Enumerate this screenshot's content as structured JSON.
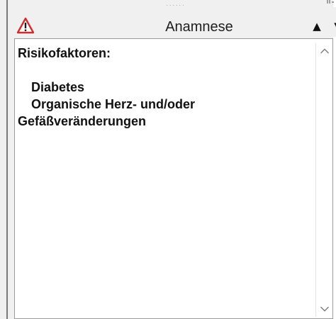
{
  "header": {
    "title": "Anamnese",
    "warning_icon": "warning-triangle-icon",
    "prev_icon": "triangle-up-icon",
    "next_icon": "triangle-down-icon",
    "prev_glyph": "▲",
    "next_glyph": "▼",
    "grip_glyph": "......",
    "accent_color": "#d12b2b"
  },
  "content": {
    "heading": "Risikofaktoren:",
    "items": [
      "Diabetes",
      "Organische Herz- und/oder",
      "Gefäßveränderungen"
    ]
  },
  "scrollbar": {
    "up_icon": "chevron-up-icon",
    "down_icon": "chevron-down-icon"
  }
}
